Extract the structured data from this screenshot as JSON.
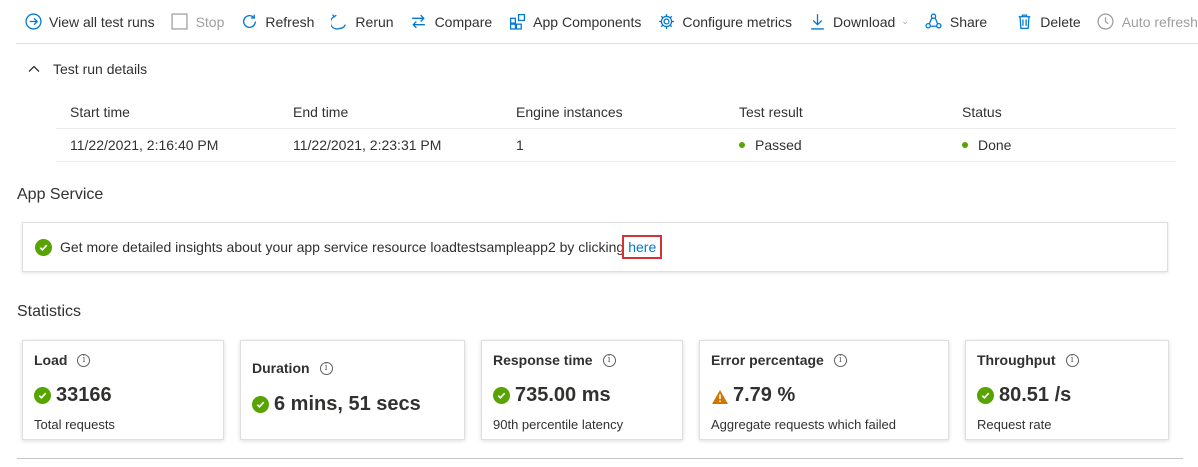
{
  "toolbar": {
    "view_all": "View all test runs",
    "stop": "Stop",
    "refresh": "Refresh",
    "rerun": "Rerun",
    "compare": "Compare",
    "app_components": "App Components",
    "configure_metrics": "Configure metrics",
    "download": "Download",
    "share": "Share",
    "delete": "Delete",
    "auto_refresh": "Auto refresh off"
  },
  "details": {
    "title": "Test run details",
    "columns": [
      "Start time",
      "End time",
      "Engine instances",
      "Test result",
      "Status"
    ],
    "row": {
      "start_time": "11/22/2021, 2:16:40 PM",
      "end_time": "11/22/2021, 2:23:31 PM",
      "engine_instances": "1",
      "test_result": "Passed",
      "status": "Done"
    }
  },
  "app_service": {
    "title": "App Service",
    "message": "Get more detailed insights about your app service resource loadtestsampleapp2 by clicking",
    "link": "here"
  },
  "statistics": {
    "title": "Statistics",
    "cards": [
      {
        "title": "Load",
        "value": "33166",
        "sub": "Total requests",
        "status": "ok"
      },
      {
        "title": "Duration",
        "value": "6 mins, 51 secs",
        "sub": "",
        "status": "ok"
      },
      {
        "title": "Response time",
        "value": "735.00 ms",
        "sub": "90th percentile latency",
        "status": "ok"
      },
      {
        "title": "Error percentage",
        "value": "7.79 %",
        "sub": "Aggregate requests which failed",
        "status": "warning"
      },
      {
        "title": "Throughput",
        "value": "80.51 /s",
        "sub": "Request rate",
        "status": "ok"
      }
    ]
  },
  "colors": {
    "accent": "#0078d4",
    "success": "#57a300",
    "warning": "#d47500",
    "highlight": "#d13438"
  }
}
